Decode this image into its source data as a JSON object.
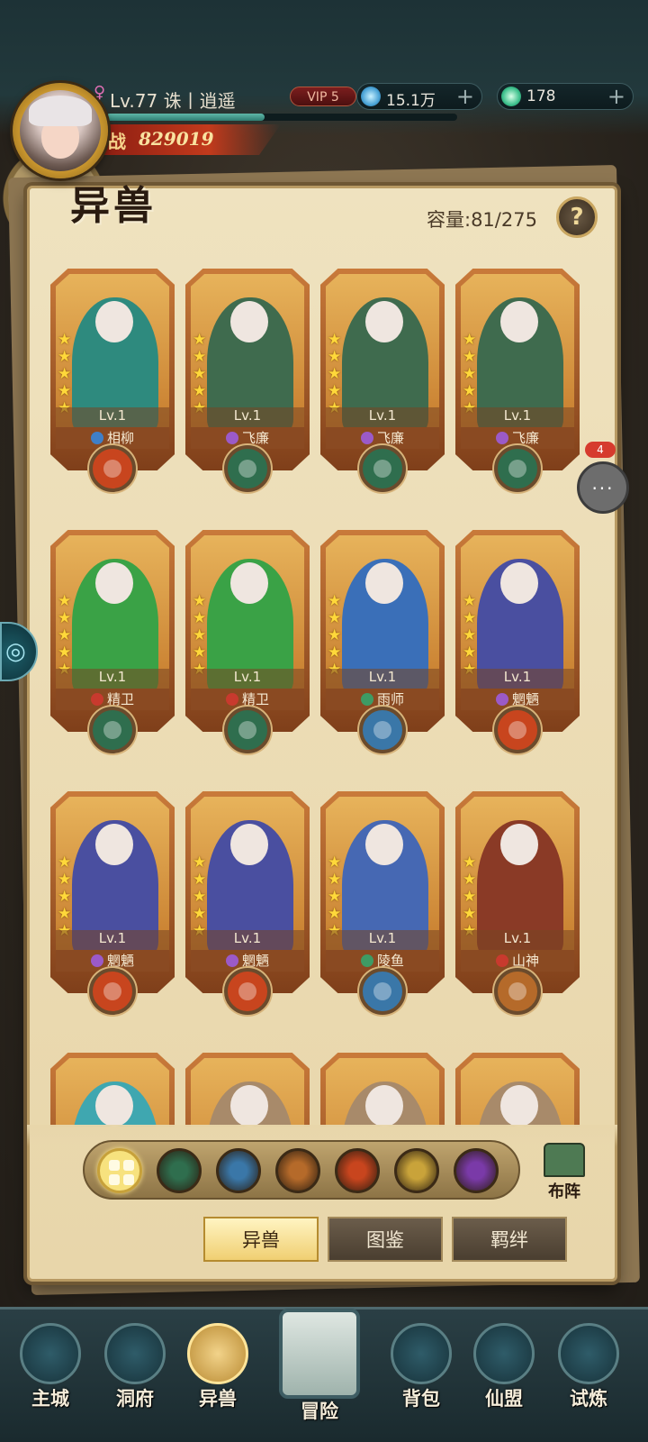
{
  "player": {
    "level_text": "Lv.77",
    "name": "诛丨逍遥",
    "gender_icon": "female-icon",
    "power_label": "战",
    "power_value": "829019",
    "vip": "VIP 5",
    "exp_fraction": 0.45
  },
  "resources": [
    {
      "icon": "spirit-stone-icon",
      "value": "15.1万",
      "plus": "+"
    },
    {
      "icon": "jade-icon",
      "value": "178",
      "plus": "+"
    }
  ],
  "page": {
    "title": "异兽",
    "capacity": "容量:81/275",
    "help": "?"
  },
  "cards": [
    {
      "level": "Lv.1",
      "name": "相柳",
      "stars": 5,
      "element": "fire",
      "art": "#2e8a7e",
      "race_color": "#3f7fc7"
    },
    {
      "level": "Lv.1",
      "name": "飞廉",
      "stars": 5,
      "element": "wood",
      "art": "#3f6b4e",
      "race_color": "#9b5ac8"
    },
    {
      "level": "Lv.1",
      "name": "飞廉",
      "stars": 5,
      "element": "wood",
      "art": "#3f6b4e",
      "race_color": "#9b5ac8"
    },
    {
      "level": "Lv.1",
      "name": "飞廉",
      "stars": 5,
      "element": "wood",
      "art": "#3f6b4e",
      "race_color": "#9b5ac8"
    },
    {
      "level": "Lv.1",
      "name": "精卫",
      "stars": 5,
      "element": "wood",
      "art": "#3aa246",
      "race_color": "#c83a2e"
    },
    {
      "level": "Lv.1",
      "name": "精卫",
      "stars": 5,
      "element": "wood",
      "art": "#3aa246",
      "race_color": "#c83a2e"
    },
    {
      "level": "Lv.1",
      "name": "雨师",
      "stars": 5,
      "element": "water",
      "art": "#3a6fb8",
      "race_color": "#3e9b64"
    },
    {
      "level": "Lv.1",
      "name": "魍魉",
      "stars": 5,
      "element": "fire",
      "art": "#4a4fa0",
      "race_color": "#9b5ac8"
    },
    {
      "level": "Lv.1",
      "name": "魍魉",
      "stars": 5,
      "element": "fire",
      "art": "#4a4fa0",
      "race_color": "#9b5ac8"
    },
    {
      "level": "Lv.1",
      "name": "魍魉",
      "stars": 5,
      "element": "fire",
      "art": "#4a4fa0",
      "race_color": "#9b5ac8"
    },
    {
      "level": "Lv.1",
      "name": "陵鱼",
      "stars": 5,
      "element": "water",
      "art": "#4668b3",
      "race_color": "#3e9b64"
    },
    {
      "level": "Lv.1",
      "name": "山神",
      "stars": 5,
      "element": "earth",
      "art": "#8a3a26",
      "race_color": "#c83a2e"
    },
    {
      "level": "",
      "name": "",
      "stars": 0,
      "element": "",
      "art": "#3fa7b0",
      "race_color": ""
    },
    {
      "level": "",
      "name": "",
      "stars": 0,
      "element": "",
      "art": "#a88a6a",
      "race_color": ""
    },
    {
      "level": "",
      "name": "",
      "stars": 0,
      "element": "",
      "art": "#a88a6a",
      "race_color": ""
    },
    {
      "level": "",
      "name": "",
      "stars": 0,
      "element": "",
      "art": "#a88a6a",
      "race_color": ""
    }
  ],
  "element_colors": {
    "fire": "#c8451e",
    "wood": "#2f6e4e",
    "water": "#3a77a8",
    "earth": "#b56a2a",
    "metal": "#c9a33a",
    "dark": "#7a3aa8"
  },
  "filters": [
    {
      "id": "all",
      "icon": "all-grid-icon",
      "color": "#f7e27e"
    },
    {
      "id": "wood",
      "icon": "wood-element-icon",
      "color": "#2f6e4e"
    },
    {
      "id": "water",
      "icon": "water-element-icon",
      "color": "#3a77a8"
    },
    {
      "id": "earth",
      "icon": "earth-element-icon",
      "color": "#b56a2a"
    },
    {
      "id": "fire",
      "icon": "fire-element-icon",
      "color": "#c8451e"
    },
    {
      "id": "light",
      "icon": "light-element-icon",
      "color": "#c9a33a"
    },
    {
      "id": "dark",
      "icon": "dark-element-icon",
      "color": "#7a3aa8"
    }
  ],
  "formation_label": "布阵",
  "tabs": [
    {
      "label": "异兽",
      "active": true
    },
    {
      "label": "图鉴",
      "active": false
    },
    {
      "label": "羁绊",
      "active": false
    }
  ],
  "chat": {
    "badge": "4",
    "icon": "chat-bubble-icon"
  },
  "side_tab_icon": "spiral-icon",
  "bottom_nav": [
    {
      "label": "主城",
      "icon": "city-icon"
    },
    {
      "label": "洞府",
      "icon": "cave-icon"
    },
    {
      "label": "异兽",
      "icon": "beast-icon",
      "active": true
    },
    {
      "label": "冒险",
      "icon": "scroll-map-icon"
    },
    {
      "label": "背包",
      "icon": "backpack-icon"
    },
    {
      "label": "仙盟",
      "icon": "alliance-icon"
    },
    {
      "label": "试炼",
      "icon": "trial-portal-icon"
    }
  ]
}
